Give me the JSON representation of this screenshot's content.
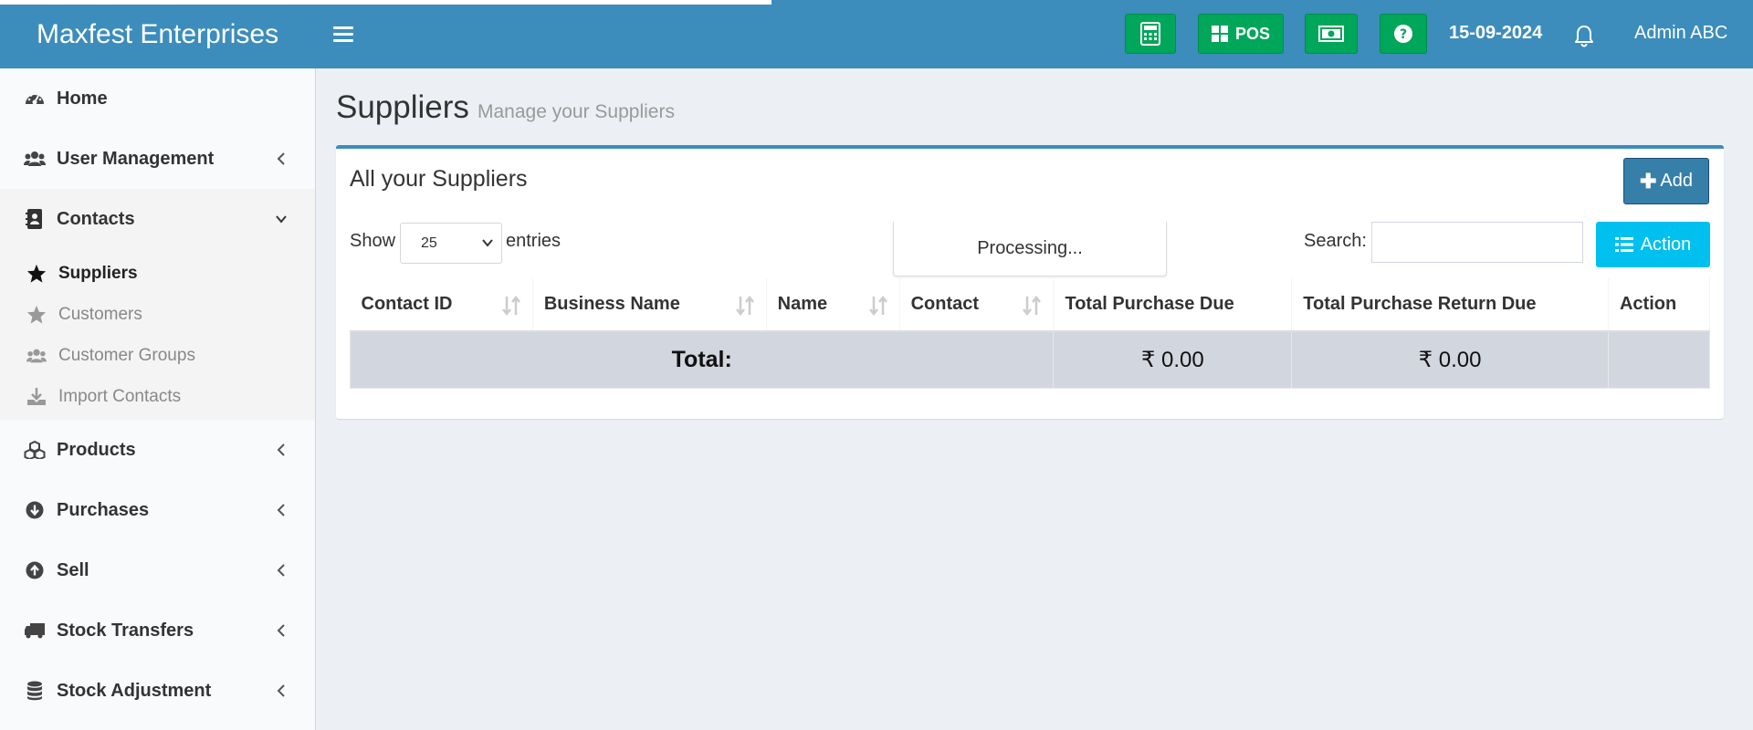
{
  "header": {
    "brand": "Maxfest Enterprises",
    "pos_label": "POS",
    "date": "15-09-2024",
    "user": "Admin ABC"
  },
  "sidebar": {
    "items": [
      {
        "label": "Home",
        "icon": "dashboard-icon"
      },
      {
        "label": "User Management",
        "icon": "users-icon"
      },
      {
        "label": "Contacts",
        "icon": "address-book-icon"
      },
      {
        "label": "Products",
        "icon": "cubes-icon"
      },
      {
        "label": "Purchases",
        "icon": "arrow-circle-down-icon"
      },
      {
        "label": "Sell",
        "icon": "arrow-circle-up-icon"
      },
      {
        "label": "Stock Transfers",
        "icon": "truck-icon"
      },
      {
        "label": "Stock Adjustment",
        "icon": "database-icon"
      }
    ],
    "contacts_sub": [
      {
        "label": "Suppliers",
        "icon": "star-icon"
      },
      {
        "label": "Customers",
        "icon": "star-icon"
      },
      {
        "label": "Customer Groups",
        "icon": "users-icon"
      },
      {
        "label": "Import Contacts",
        "icon": "download-icon"
      }
    ]
  },
  "page": {
    "title": "Suppliers",
    "subtitle": "Manage your Suppliers"
  },
  "box": {
    "title": "All your Suppliers",
    "add_label": "Add",
    "show_label": "Show",
    "entries_value": "25",
    "entries_label": "entries",
    "processing": "Processing...",
    "search_label": "Search:",
    "search_value": "",
    "action_label": "Action"
  },
  "table": {
    "columns": [
      "Contact ID",
      "Business Name",
      "Name",
      "Contact",
      "Total Purchase Due",
      "Total Purchase Return Due",
      "Action"
    ],
    "footer": {
      "total_label": "Total:",
      "purchase_due": "₹ 0.00",
      "return_due": "₹ 0.00"
    }
  },
  "colors": {
    "header_bg": "#3c8dbc",
    "green_btn": "#00a65a",
    "add_btn": "#367fa9",
    "action_btn": "#00c0ef"
  }
}
